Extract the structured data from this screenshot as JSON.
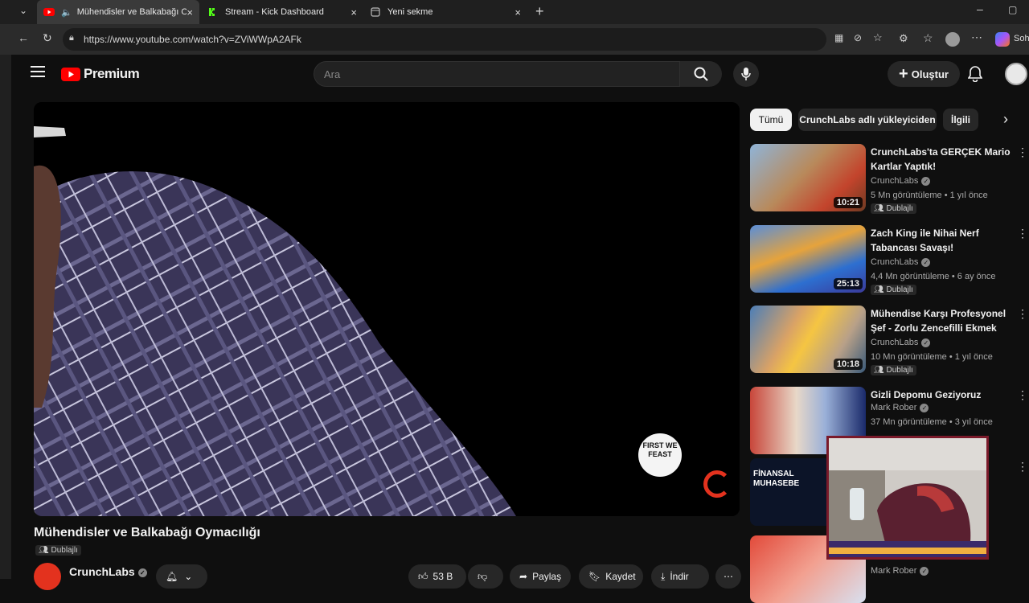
{
  "browser": {
    "tabs": [
      {
        "label": "Mühendisler ve Balkabağı Oymacılığı",
        "active": true
      },
      {
        "label": "Stream - Kick Dashboard",
        "active": false
      },
      {
        "label": "Yeni sekme",
        "active": false
      }
    ],
    "url": "https://www.youtube.com/watch?v=ZViWWpA2AFk",
    "sidebar_label": "Soh"
  },
  "header": {
    "logo_text": "Premium",
    "search_placeholder": "Ara",
    "create_label": "Oluştur"
  },
  "player": {
    "overlay_badge": "FIRST WE FEAST"
  },
  "chips": [
    {
      "label": "Tümü",
      "active": true
    },
    {
      "label": "CrunchLabs adlı yükleyiciden",
      "active": false
    },
    {
      "label": "İlgili",
      "active": false
    }
  ],
  "recommended": [
    {
      "title": "CrunchLabs'ta GERÇEK Mario Kartlar Yaptık!",
      "channel": "CrunchLabs",
      "meta": "5 Mn görüntüleme • 1 yıl önce",
      "badge": "Dublajlı",
      "duration": "10:21"
    },
    {
      "title": "Zach King ile Nihai Nerf Tabancası Savaşı!",
      "channel": "CrunchLabs",
      "meta": "4,4 Mn görüntüleme • 6 ay önce",
      "badge": "Dublajlı",
      "duration": "25:13"
    },
    {
      "title": "Mühendise Karşı Profesyonel Şef - Zorlu Zencefilli Ekmek Ev...",
      "channel": "CrunchLabs",
      "meta": "10 Mn görüntüleme • 1 yıl önce",
      "badge": "Dublajlı",
      "duration": "10:18"
    },
    {
      "title": "Gizli Depomu Geziyoruz",
      "channel": "Mark Rober",
      "meta": "37 Mn görüntüleme • 3 yıl önce",
      "badge": "",
      "duration": ""
    },
    {
      "title": "",
      "channel": "",
      "meta": "",
      "badge": "",
      "duration": "",
      "thumb_text": "FİNANSAL MUHASEBE"
    },
    {
      "title": "Tellehi ralal Mu?",
      "channel": "Mark Rober",
      "meta": "",
      "badge": "",
      "duration": ""
    }
  ],
  "video": {
    "title": "Mühendisler ve Balkabağı Oymacılığı",
    "badge": "Dublajlı",
    "channel": "CrunchLabs",
    "likes": "53 B",
    "share_label": "Paylaş",
    "save_label": "Kaydet",
    "download_label": "İndir"
  },
  "colors": {
    "accent": "#ff0000",
    "bg": "#0f0f0f",
    "chip_bg": "#272727"
  }
}
